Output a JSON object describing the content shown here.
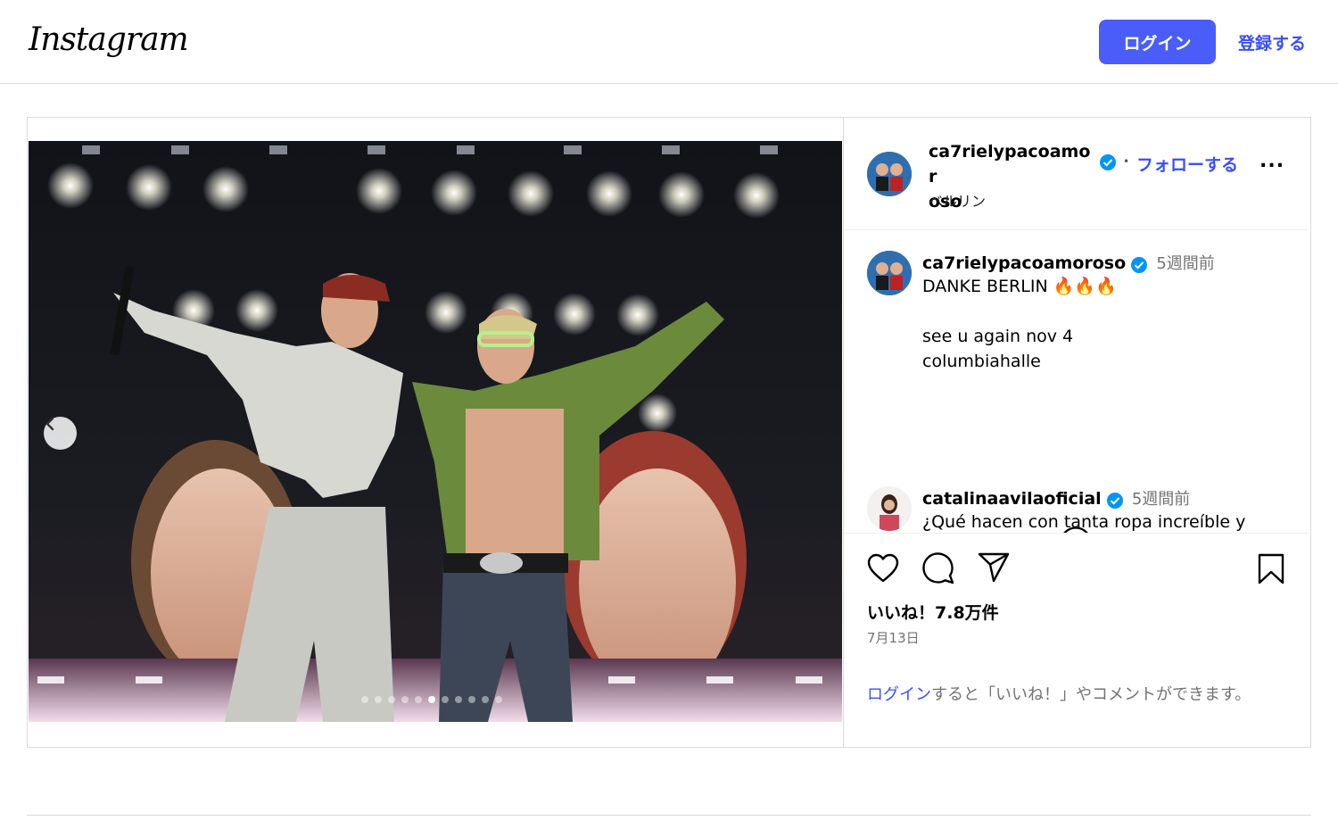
{
  "header": {
    "logo_text": "Instagram",
    "login_label": "ログイン",
    "signup_label": "登録する"
  },
  "post": {
    "author": "ca7rielypacoamoroso",
    "author_display": "ca7rielypacoamor\noso",
    "follow_label": "フォローする",
    "location": "ベルリン",
    "more_label": "...",
    "carousel_dots": 11,
    "carousel_active": 5,
    "caption": {
      "username": "ca7rielypacoamoroso",
      "time": "5週間前",
      "text": "DANKE BERLIN 🔥🔥🔥\n\nsee u again nov 4\ncolumbiahalle"
    },
    "comments": [
      {
        "username": "catalinaavilaoficial",
        "time": "5週間前",
        "text": "¿Qué hacen con tanta ropa increíble y"
      }
    ],
    "likes": "いいね！7.8万件",
    "date": "7月13日",
    "login_prompt_link": "ログイン",
    "login_prompt_rest": "すると「いいね！」やコメントができます。"
  },
  "icons": {
    "like": "heart-icon",
    "comment": "comment-icon",
    "share": "share-icon",
    "save": "bookmark-icon",
    "prev": "chevron-left-icon",
    "load_more": "plus-circle-icon",
    "verified": "verified-badge-icon"
  },
  "colors": {
    "primary_button": "#4a5df9",
    "link": "#3b4ff5",
    "verified": "#0095f6",
    "muted_text": "#737373",
    "border": "#dbdbdb"
  }
}
